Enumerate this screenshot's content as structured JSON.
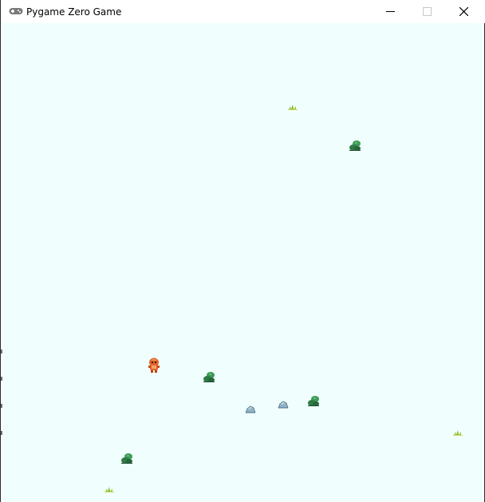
{
  "window": {
    "title": "Pygame Zero Game",
    "controls": {
      "minimize": "minimize",
      "maximize": "maximize",
      "close": "close"
    }
  },
  "game": {
    "background_color": "#f0fffe",
    "sprites": [
      {
        "kind": "player",
        "icon": "orange-creature-icon"
      },
      {
        "kind": "bush",
        "icon": "green-bush-icon"
      },
      {
        "kind": "bush",
        "icon": "green-bush-icon"
      },
      {
        "kind": "bush",
        "icon": "green-bush-icon"
      },
      {
        "kind": "bush",
        "icon": "green-bush-icon"
      },
      {
        "kind": "rock",
        "icon": "blue-rock-icon"
      },
      {
        "kind": "rock",
        "icon": "blue-rock-icon"
      },
      {
        "kind": "grass",
        "icon": "grass-tuft-icon"
      },
      {
        "kind": "grass",
        "icon": "grass-tuft-icon"
      },
      {
        "kind": "grass",
        "icon": "grass-tuft-icon"
      }
    ]
  },
  "colors": {
    "player": "#e0642a",
    "bush": "#2f7a45",
    "rock": "#8fb4c8",
    "grass": "#9ccc3c"
  }
}
